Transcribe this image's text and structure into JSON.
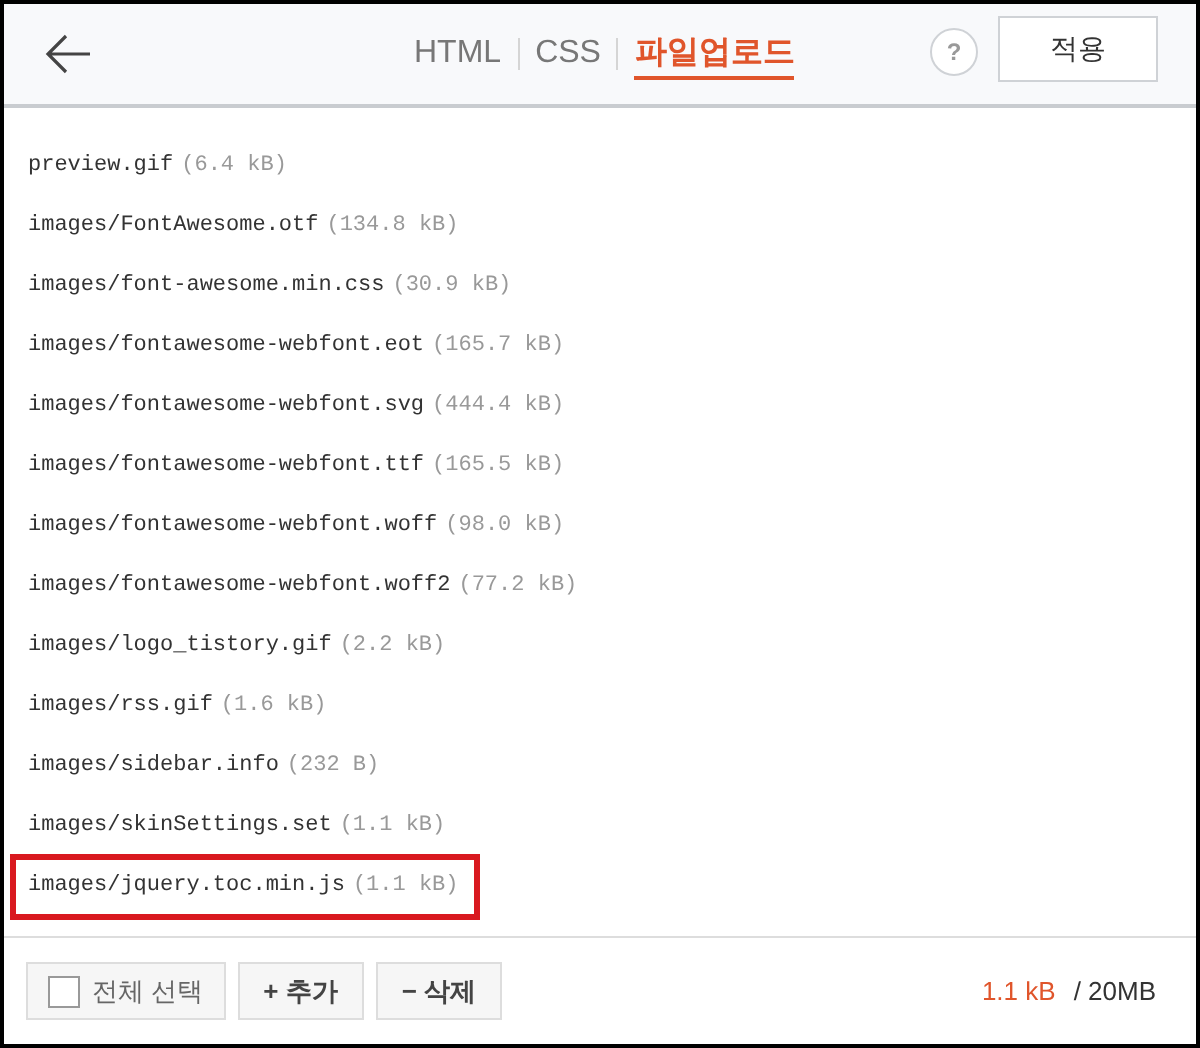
{
  "header": {
    "tabs": [
      {
        "label": "HTML",
        "selected": false
      },
      {
        "label": "CSS",
        "selected": false
      },
      {
        "label": "파일업로드",
        "selected": true
      }
    ],
    "help": "?",
    "apply_button": "적용"
  },
  "files": [
    {
      "name": "preview.gif",
      "size": "(6.4 kB)",
      "highlighted": false
    },
    {
      "name": "images/FontAwesome.otf",
      "size": "(134.8 kB)",
      "highlighted": false
    },
    {
      "name": "images/font-awesome.min.css",
      "size": "(30.9 kB)",
      "highlighted": false
    },
    {
      "name": "images/fontawesome-webfont.eot",
      "size": "(165.7 kB)",
      "highlighted": false
    },
    {
      "name": "images/fontawesome-webfont.svg",
      "size": "(444.4 kB)",
      "highlighted": false
    },
    {
      "name": "images/fontawesome-webfont.ttf",
      "size": "(165.5 kB)",
      "highlighted": false
    },
    {
      "name": "images/fontawesome-webfont.woff",
      "size": "(98.0 kB)",
      "highlighted": false
    },
    {
      "name": "images/fontawesome-webfont.woff2",
      "size": "(77.2 kB)",
      "highlighted": false
    },
    {
      "name": "images/logo_tistory.gif",
      "size": "(2.2 kB)",
      "highlighted": false
    },
    {
      "name": "images/rss.gif",
      "size": "(1.6 kB)",
      "highlighted": false
    },
    {
      "name": "images/sidebar.info",
      "size": "(232 B)",
      "highlighted": false
    },
    {
      "name": "images/skinSettings.set",
      "size": "(1.1 kB)",
      "highlighted": false
    },
    {
      "name": "images/jquery.toc.min.js",
      "size": "(1.1 kB)",
      "highlighted": true
    }
  ],
  "footer": {
    "select_all": {
      "label": "전체 선택",
      "checked": false
    },
    "add_button": "+ 추가",
    "delete_button": "− 삭제",
    "used": "1.1 kB",
    "limit": "/ 20MB"
  }
}
